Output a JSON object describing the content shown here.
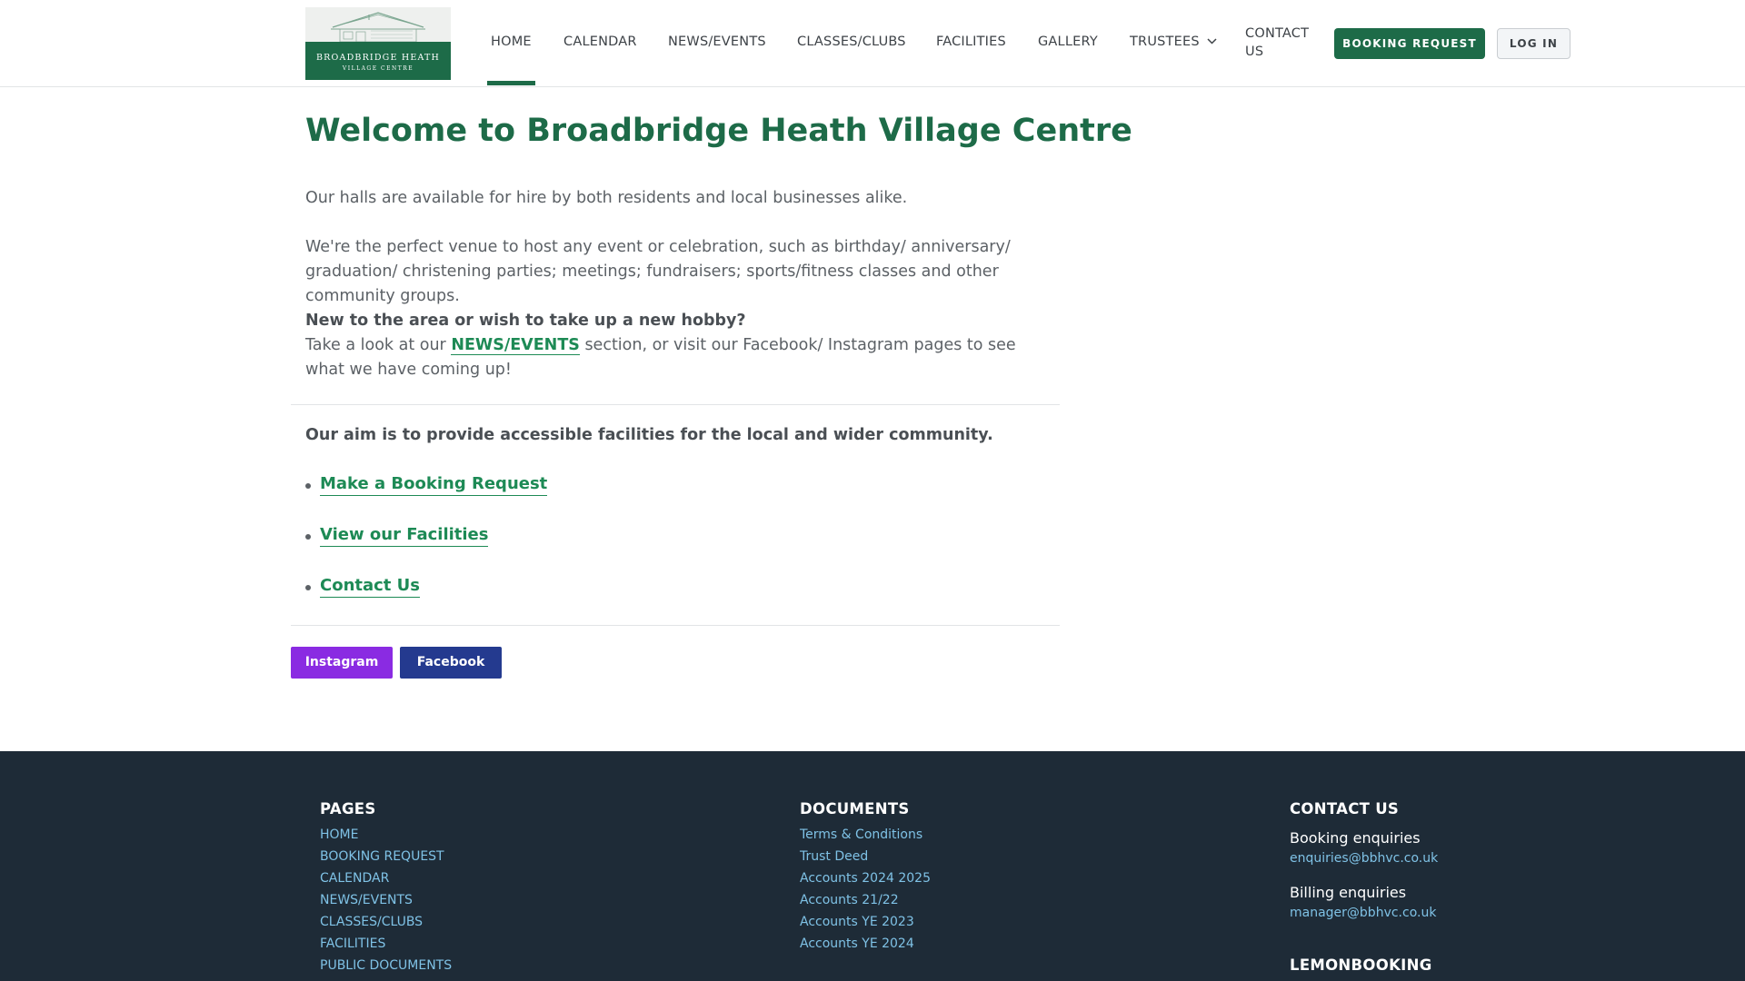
{
  "header": {
    "logo": {
      "name": "BROADBRIDGE HEATH",
      "subtitle": "VILLAGE CENTRE"
    },
    "nav": {
      "home": "HOME",
      "calendar": "CALENDAR",
      "news_events": "NEWS/EVENTS",
      "classes_clubs": "CLASSES/CLUBS",
      "facilities": "FACILITIES",
      "gallery": "GALLERY",
      "trustees": "TRUSTEES",
      "contact_line1": "CONTACT",
      "contact_line2": "US",
      "active": "HOME"
    },
    "booking_button": "BOOKING REQUEST",
    "login_button": "LOG IN"
  },
  "main": {
    "title": "Welcome to Broadbridge Heath Village Centre",
    "intro": "Our halls are available for hire by both residents and local businesses alike.",
    "venue_text": "We're the perfect venue to host any event or celebration, such as birthday/ anniversary/ graduation/ christening parties; meetings; fundraisers; sports/fitness classes and other community groups.",
    "new_heading": "New to the area or wish to take up a new hobby?",
    "new_text_before": "Take a look at our ",
    "new_text_link": "NEWS/EVENTS",
    "new_text_after": " section, or visit our Facebook/ Instagram pages to see what we have coming up!",
    "aim": "Our aim is to provide accessible facilities for the local and wider community.",
    "links": {
      "booking": "Make a Booking Request",
      "facilities": "View our Facilities",
      "contact": "Contact Us"
    },
    "social": {
      "instagram": "Instagram",
      "facebook": "Facebook"
    }
  },
  "footer": {
    "pages": {
      "heading": "PAGES",
      "home": "HOME",
      "booking_request": "BOOKING REQUEST",
      "calendar": "CALENDAR",
      "news_events": "NEWS/EVENTS",
      "classes_clubs": "CLASSES/CLUBS",
      "facilities": "FACILITIES",
      "public_documents": "PUBLIC DOCUMENTS"
    },
    "documents": {
      "heading": "DOCUMENTS",
      "terms": "Terms & Conditions",
      "trust_deed": "Trust Deed",
      "accounts_2024_2025": "Accounts 2024 2025",
      "accounts_21_22": "Accounts 21/22",
      "accounts_ye_2023": "Accounts YE 2023",
      "accounts_ye_2024": "Accounts YE 2024"
    },
    "contact": {
      "heading": "CONTACT US",
      "booking_label": "Booking enquiries",
      "booking_email": "enquiries@bbhvc.co.uk",
      "billing_label": "Billing enquiries",
      "billing_email": "manager@bbhvc.co.uk"
    },
    "lemonbooking": "LEMONBOOKING"
  },
  "colors": {
    "brand_green": "#1d6b48",
    "link_green": "#1d8a55",
    "instagram": "#8a2be2",
    "facebook": "#243a8f",
    "footer_bg": "#1e2b37",
    "footer_link": "#7fc2e6"
  }
}
